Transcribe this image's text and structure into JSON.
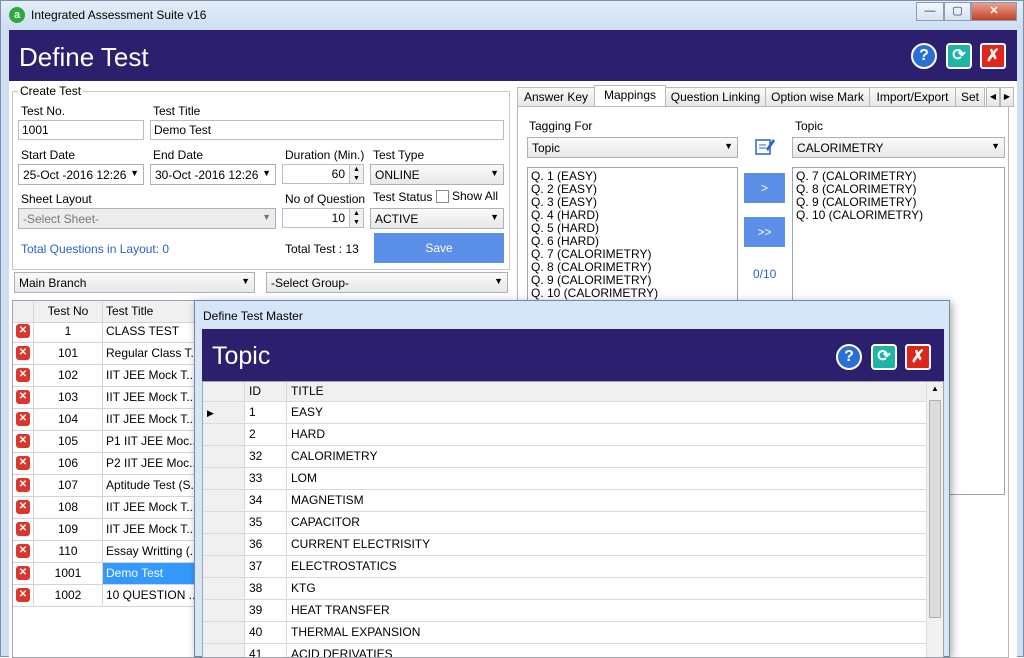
{
  "window": {
    "title": "Integrated Assessment Suite v16",
    "app_icon_letter": "a",
    "minimize": "—",
    "maximize": "▢",
    "close": "✕"
  },
  "banner": {
    "title": "Define Test",
    "help": "?",
    "refresh": "⟳",
    "close": "✗"
  },
  "create_test": {
    "group_label": "Create Test",
    "test_no_label": "Test No.",
    "test_no": "1001",
    "test_title_label": "Test Title",
    "test_title": "Demo Test",
    "start_date_label": "Start Date",
    "start_date": "25-Oct -2016 12:26",
    "end_date_label": "End Date",
    "end_date": "30-Oct -2016 12:26",
    "duration_label": "Duration (Min.)",
    "duration": "60",
    "test_type_label": "Test Type",
    "test_type": "ONLINE",
    "sheet_layout_label": "Sheet Layout",
    "sheet_layout": "-Select Sheet-",
    "no_question_label": "No of Question",
    "no_question": "10",
    "test_status_label": "Test Status",
    "test_status": "ACTIVE",
    "show_all_label": "Show All",
    "total_questions": "Total Questions in Layout: 0",
    "total_test": "Total Test : 13",
    "save_label": "Save"
  },
  "filters": {
    "branch": "Main Branch",
    "group": "-Select Group-"
  },
  "test_grid": {
    "headers": [
      "Test No",
      "Test Title"
    ],
    "rows": [
      {
        "no": "1",
        "title": "CLASS TEST"
      },
      {
        "no": "101",
        "title": "Regular Class T..."
      },
      {
        "no": "102",
        "title": "IIT JEE Mock T..."
      },
      {
        "no": "103",
        "title": "IIT JEE Mock T..."
      },
      {
        "no": "104",
        "title": "IIT JEE Mock T..."
      },
      {
        "no": "105",
        "title": "P1 IIT JEE Moc..."
      },
      {
        "no": "106",
        "title": "P2 IIT JEE Moc..."
      },
      {
        "no": "107",
        "title": "Aptitude Test (S..."
      },
      {
        "no": "108",
        "title": "IIT JEE Mock T..."
      },
      {
        "no": "109",
        "title": "IIT JEE Mock T..."
      },
      {
        "no": "110",
        "title": "Essay Writting (..."
      },
      {
        "no": "1001",
        "title": "Demo Test"
      },
      {
        "no": "1002",
        "title": "10 QUESTION ..."
      }
    ]
  },
  "tabs": [
    "Answer Key",
    "Mappings",
    "Question Linking",
    "Option wise Mark",
    "Import/Export",
    "Set"
  ],
  "mappings": {
    "tagging_for_label": "Tagging For",
    "tagging_for": "Topic",
    "topic_label": "Topic",
    "topic": "CALORIMETRY",
    "left_items": [
      "Q. 1 (EASY)",
      "Q. 2 (EASY)",
      "Q. 3 (EASY)",
      "Q. 4 (HARD)",
      "Q. 5 (HARD)",
      "Q. 6 (HARD)",
      "Q. 7 (CALORIMETRY)",
      "Q. 8 (CALORIMETRY)",
      "Q. 9 (CALORIMETRY)",
      "Q. 10 (CALORIMETRY)"
    ],
    "right_items": [
      "Q. 7 (CALORIMETRY)",
      "Q. 8 (CALORIMETRY)",
      "Q. 9 (CALORIMETRY)",
      "Q. 10 (CALORIMETRY)"
    ],
    "move_one": ">",
    "move_all": ">>",
    "counter": "0/10"
  },
  "dialog": {
    "window_title": "Define Test Master",
    "title": "Topic",
    "headers": [
      "ID",
      "TITLE"
    ],
    "rows": [
      {
        "id": "1",
        "title": "EASY"
      },
      {
        "id": "2",
        "title": "HARD"
      },
      {
        "id": "32",
        "title": "CALORIMETRY"
      },
      {
        "id": "33",
        "title": "LOM"
      },
      {
        "id": "34",
        "title": "MAGNETISM"
      },
      {
        "id": "35",
        "title": "CAPACITOR"
      },
      {
        "id": "36",
        "title": "CURRENT ELECTRISITY"
      },
      {
        "id": "37",
        "title": "ELECTROSTATICS"
      },
      {
        "id": "38",
        "title": "KTG"
      },
      {
        "id": "39",
        "title": "HEAT TRANSFER"
      },
      {
        "id": "40",
        "title": "THERMAL EXPANSION"
      },
      {
        "id": "41",
        "title": "ACID DERIVATIES"
      }
    ]
  }
}
